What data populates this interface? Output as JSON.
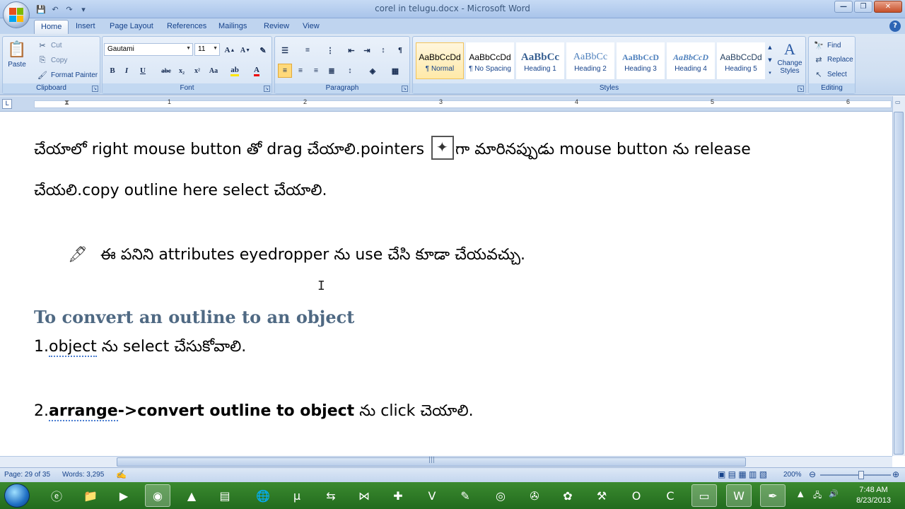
{
  "window": {
    "title": "corel in telugu.docx - Microsoft Word",
    "controls": {
      "minimize": "—",
      "maximize": "❐",
      "close": "✕"
    }
  },
  "tabs": [
    "Home",
    "Insert",
    "Page Layout",
    "References",
    "Mailings",
    "Review",
    "View"
  ],
  "active_tab": "Home",
  "ribbon": {
    "clipboard": {
      "label": "Clipboard",
      "paste": "Paste",
      "cut": "Cut",
      "copy": "Copy",
      "format_painter": "Format Painter"
    },
    "font": {
      "label": "Font",
      "font_name": "Gautami",
      "font_size": "11"
    },
    "paragraph": {
      "label": "Paragraph"
    },
    "styles": {
      "label": "Styles",
      "items": [
        {
          "sample": "AaBbCcDd",
          "name": "¶ Normal"
        },
        {
          "sample": "AaBbCcDd",
          "name": "¶ No Spacing"
        },
        {
          "sample": "AaBbCc",
          "name": "Heading 1"
        },
        {
          "sample": "AaBbCc",
          "name": "Heading 2"
        },
        {
          "sample": "AaBbCcD",
          "name": "Heading 3"
        },
        {
          "sample": "AaBbCcD",
          "name": "Heading 4"
        },
        {
          "sample": "AaBbCcDd",
          "name": "Heading 5"
        }
      ],
      "change_styles": "Change Styles"
    },
    "editing": {
      "label": "Editing",
      "find": "Find",
      "replace": "Replace",
      "select": "Select"
    }
  },
  "ruler": {
    "numbers": [
      "1",
      "2",
      "3",
      "4",
      "5",
      "6"
    ]
  },
  "document": {
    "line1_a": "చేయాలో right mouse button తో drag చేయాలి.pointers",
    "line1_b": "గా మారినప్పుడు mouse button ను release",
    "line2": "చేయలి.copy outline here select చేయాలి.",
    "bullet": "ఈ పనిని attributes eyedropper ను use చేసి కూడా చేయవచ్చు.",
    "heading": "To convert an outline to an object",
    "step1_num": "1.",
    "step1_word": "object",
    "step1_rest": " ను select చేసుకోవాలి.",
    "step2_num": "2.",
    "step2_word": "arrange",
    "step2_bold": "->convert outline to object",
    "step2_rest": " ను click చెయాలి."
  },
  "status": {
    "page": "Page: 29 of 35",
    "words": "Words: 3,295",
    "zoom": "200%"
  },
  "taskbar": {
    "time": "7:48 AM",
    "date": "8/23/2013"
  }
}
